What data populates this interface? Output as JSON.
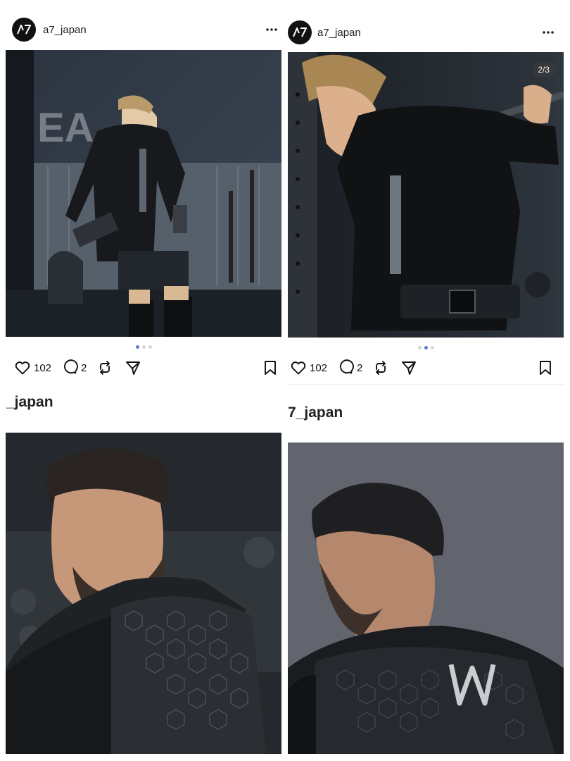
{
  "posts": [
    {
      "username": "a7_japan",
      "likes": "102",
      "comments": "2",
      "caption_user": "_japan",
      "carousel": {
        "count": 3,
        "active": 1
      }
    },
    {
      "username": "a7_japan",
      "likes": "102",
      "comments": "2",
      "counter": "2/3",
      "caption_user": "7_japan",
      "carousel": {
        "count": 3,
        "active": 2
      }
    }
  ],
  "icons": {
    "avatar": "a7-logo-icon",
    "more": "more-options-icon",
    "like": "heart-icon",
    "comment": "comment-icon",
    "repost": "repost-icon",
    "share": "send-icon",
    "save": "bookmark-icon"
  },
  "colors": {
    "carousel_active": "#5b7bd5",
    "carousel_inactive": "#d6d6d6"
  }
}
